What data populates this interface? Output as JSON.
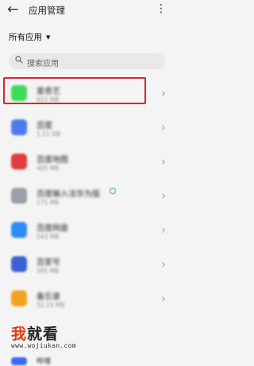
{
  "header": {
    "back_icon": "←",
    "title": "应用管理",
    "more_icon": "⋮"
  },
  "filter": {
    "label": "所有应用",
    "caret": "▼"
  },
  "search": {
    "placeholder": "搜索应用"
  },
  "apps": [
    {
      "name": "爱奇艺",
      "size": "622 MB",
      "icon_color": "#3ddc58"
    },
    {
      "name": "百度",
      "size": "1.21 GB",
      "icon_color": "#4a7cf0"
    },
    {
      "name": "百度地图",
      "size": "405 MB",
      "icon_color": "#e23b3b"
    },
    {
      "name": "百度输入法华为版",
      "size": "171 MB",
      "icon_color": "#9aa0a8"
    },
    {
      "name": "百度网盘",
      "size": "543 MB",
      "icon_color": "#2f8cf5"
    },
    {
      "name": "百家号",
      "size": "165 MB",
      "icon_color": "#3a62d6"
    },
    {
      "name": "备忘录",
      "size": "51.23 MB",
      "icon_color": "#f2a21f"
    }
  ],
  "watermark": {
    "prefix": "我",
    "rest": "就看",
    "url": "www.wojiukan.com"
  },
  "partial_item": {
    "name": "哔哩",
    "icon_color": "#3a6cf4"
  }
}
